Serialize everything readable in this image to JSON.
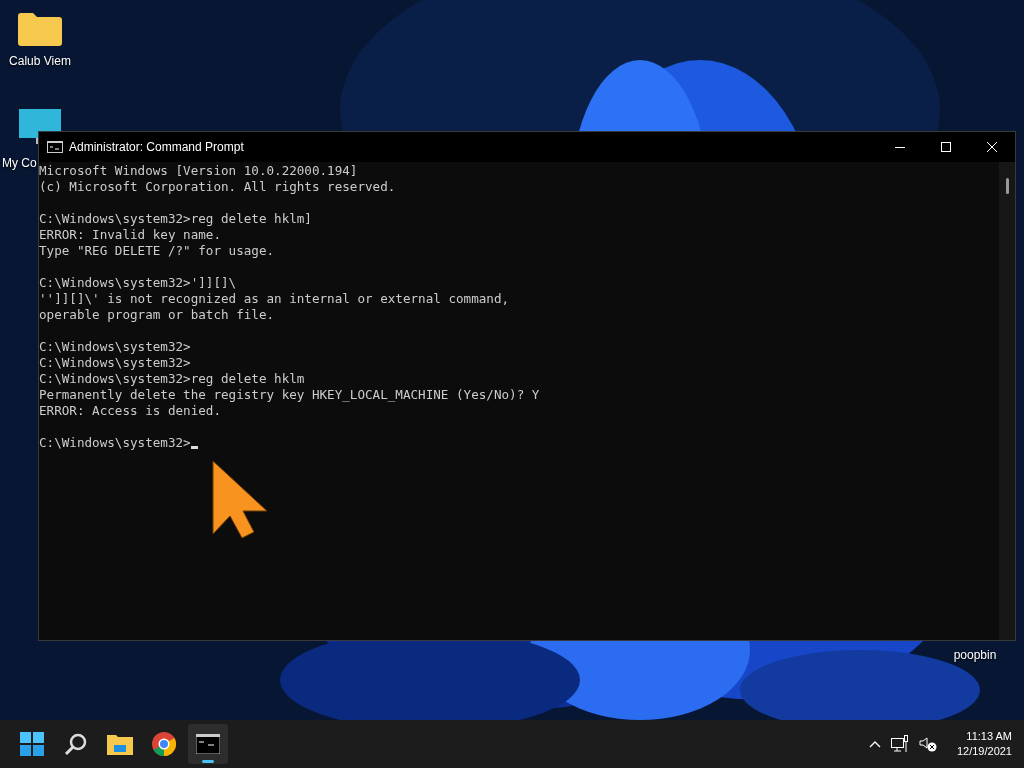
{
  "desktop_icons": [
    {
      "kind": "folder",
      "label": "Calub Viem"
    },
    {
      "kind": "computer",
      "label": "My Co"
    },
    {
      "kind": "bin",
      "label": "poopbin"
    }
  ],
  "window": {
    "title": "Administrator: Command Prompt",
    "blocks": [
      [
        "Microsoft Windows [Version 10.0.22000.194]",
        "(c) Microsoft Corporation. All rights reserved."
      ],
      [
        "C:\\Windows\\system32>reg delete hklm]",
        "ERROR: Invalid key name.",
        "Type \"REG DELETE /?\" for usage."
      ],
      [
        "C:\\Windows\\system32>']][]\\",
        "'']][]\\' is not recognized as an internal or external command,",
        "operable program or batch file."
      ],
      [
        "C:\\Windows\\system32>",
        "C:\\Windows\\system32>",
        "C:\\Windows\\system32>reg delete hklm",
        "Permanently delete the registry key HKEY_LOCAL_MACHINE (Yes/No)? Y",
        "ERROR: Access is denied."
      ],
      [
        "C:\\Windows\\system32>"
      ]
    ]
  },
  "taskbar": {
    "apps": [
      {
        "kind": "start",
        "selected": false
      },
      {
        "kind": "search",
        "selected": false
      },
      {
        "kind": "explorer",
        "selected": false
      },
      {
        "kind": "chrome",
        "selected": false
      },
      {
        "kind": "terminal",
        "selected": true
      }
    ],
    "clock": {
      "time": "11:13 AM",
      "date": "12/19/2021"
    }
  }
}
